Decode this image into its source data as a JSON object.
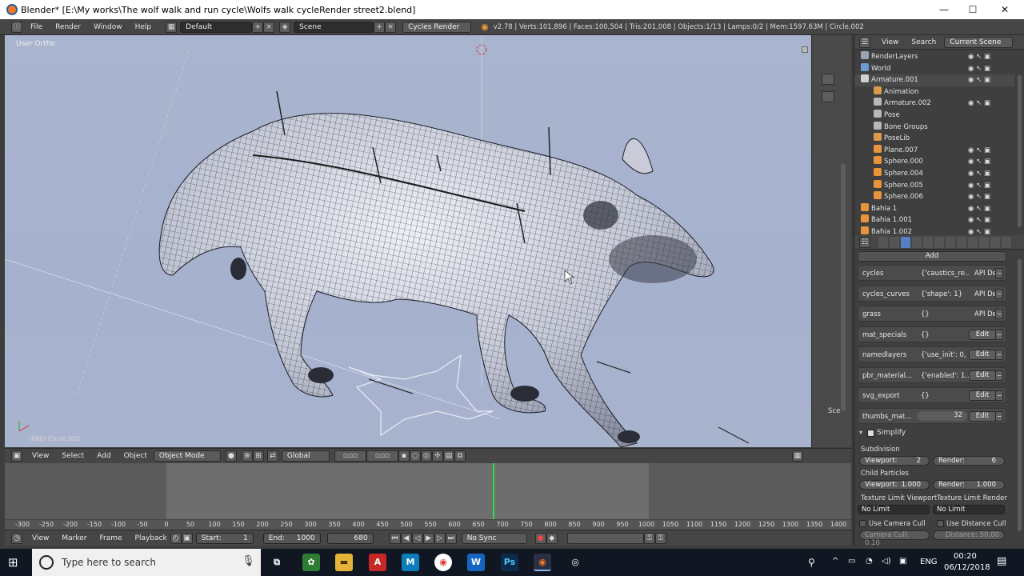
{
  "window": {
    "title": "Blender* [E:\\My works\\The wolf walk and run cycle\\Wolfs walk cycleRender street2.blend]",
    "minimize": "—",
    "maximize": "☐",
    "close": "✕"
  },
  "info": {
    "menus": [
      "File",
      "Render",
      "Window",
      "Help"
    ],
    "layout": "Default",
    "scene": "Scene",
    "engine": "Cycles Render",
    "stats": "v2.78 | Verts:101,896 | Faces:100,504 | Tris:201,008 | Objects:1/13 | Lamps:0/2 | Mem:1597.63M | Circle.002"
  },
  "viewport": {
    "view_label": "User Ortho",
    "object_label": "(680) Circle.002",
    "side_label": "Sce"
  },
  "view3d_header": {
    "menus": [
      "View",
      "Select",
      "Add",
      "Object"
    ],
    "mode": "Object Mode",
    "orientation": "Global"
  },
  "timeline": {
    "ticks": [
      "-300",
      "-250",
      "-200",
      "-150",
      "-100",
      "-50",
      "0",
      "50",
      "100",
      "150",
      "200",
      "250",
      "300",
      "350",
      "400",
      "450",
      "500",
      "550",
      "600",
      "650",
      "700",
      "750",
      "800",
      "850",
      "900",
      "950",
      "1000",
      "1050",
      "1100",
      "1150",
      "1200",
      "1250",
      "1300",
      "1350",
      "1400"
    ],
    "current_frame": 680,
    "menus": [
      "View",
      "Marker",
      "Frame",
      "Playback"
    ],
    "start_label": "Start:",
    "start": "1",
    "end_label": "End:",
    "end": "1000",
    "frame": "680",
    "sync": "No Sync"
  },
  "outliner": {
    "header": {
      "view": "View",
      "search": "Search",
      "scene": "Current Scene"
    },
    "rows": [
      {
        "label": "RenderLayers",
        "indent": 0,
        "color": "#9aa3b0"
      },
      {
        "label": "World",
        "indent": 0,
        "color": "#6e9ad1"
      },
      {
        "label": "Armature.001",
        "indent": 0,
        "color": "#d0d0d0"
      },
      {
        "label": "Animation",
        "indent": 1,
        "color": "#d99a4a"
      },
      {
        "label": "Armature.002",
        "indent": 1,
        "color": "#b8b8b8"
      },
      {
        "label": "Pose",
        "indent": 1,
        "color": "#b8b8b8"
      },
      {
        "label": "Bone Groups",
        "indent": 1,
        "color": "#b8b8b8"
      },
      {
        "label": "PoseLib",
        "indent": 1,
        "color": "#d99a4a"
      },
      {
        "label": "Plane.007",
        "indent": 1,
        "color": "#e8943a"
      },
      {
        "label": "Sphere.000",
        "indent": 1,
        "color": "#e8943a"
      },
      {
        "label": "Sphere.004",
        "indent": 1,
        "color": "#e8943a"
      },
      {
        "label": "Sphere.005",
        "indent": 1,
        "color": "#e8943a"
      },
      {
        "label": "Sphere.006",
        "indent": 1,
        "color": "#e8943a"
      },
      {
        "label": "Bahia 1",
        "indent": 0,
        "color": "#e8943a"
      },
      {
        "label": "Bahia 1.001",
        "indent": 0,
        "color": "#e8943a"
      },
      {
        "label": "Bahia 1.002",
        "indent": 0,
        "color": "#e8943a"
      }
    ]
  },
  "properties": {
    "add": "Add",
    "rows": [
      {
        "key": "cycles",
        "value": "{'caustics_re...",
        "action": "API De"
      },
      {
        "key": "cycles_curves",
        "value": "{'shape': 1}",
        "action": "API De"
      },
      {
        "key": "grass",
        "value": "{}",
        "action": "API De"
      },
      {
        "key": "mat_specials",
        "value": "{}",
        "action": "Edit"
      },
      {
        "key": "namedlayers",
        "value": "{'use_init': 0,",
        "action": "Edit"
      },
      {
        "key": "pbr_material...",
        "value": "{'enabled': 1...",
        "action": "Edit"
      },
      {
        "key": "svg_export",
        "value": "{}",
        "action": "Edit"
      },
      {
        "key": "thumbs_mat...",
        "value": "32",
        "action": "Edit"
      }
    ],
    "simplify": {
      "title": "Simplify",
      "subdivision": "Subdivision",
      "viewport_label": "Viewport:",
      "viewport": "2",
      "render_label": "Render:",
      "render": "6",
      "child_particles": "Child Particles",
      "cp_viewport": "1.000",
      "cp_render": "1.000",
      "tex_limit_viewport": "Texture Limit Viewport",
      "tex_limit_render": "Texture Limit Render",
      "no_limit_1": "No Limit",
      "no_limit_2": "No Limit",
      "use_camera_cull": "Use Camera Cull",
      "use_distance_cull": "Use Distance Cull",
      "camera_cull": "Camera Cull: 0.10",
      "distance": "Distance: 50.00"
    }
  },
  "taskbar": {
    "search_placeholder": "Type here to search",
    "time": "00:20",
    "date": "06/12/2018",
    "lang": "ENG"
  },
  "colors": {
    "accent_blue": "#5680c2",
    "timeline_cursor": "#2ee03f",
    "viewport_bg": "#a8b3ce"
  }
}
